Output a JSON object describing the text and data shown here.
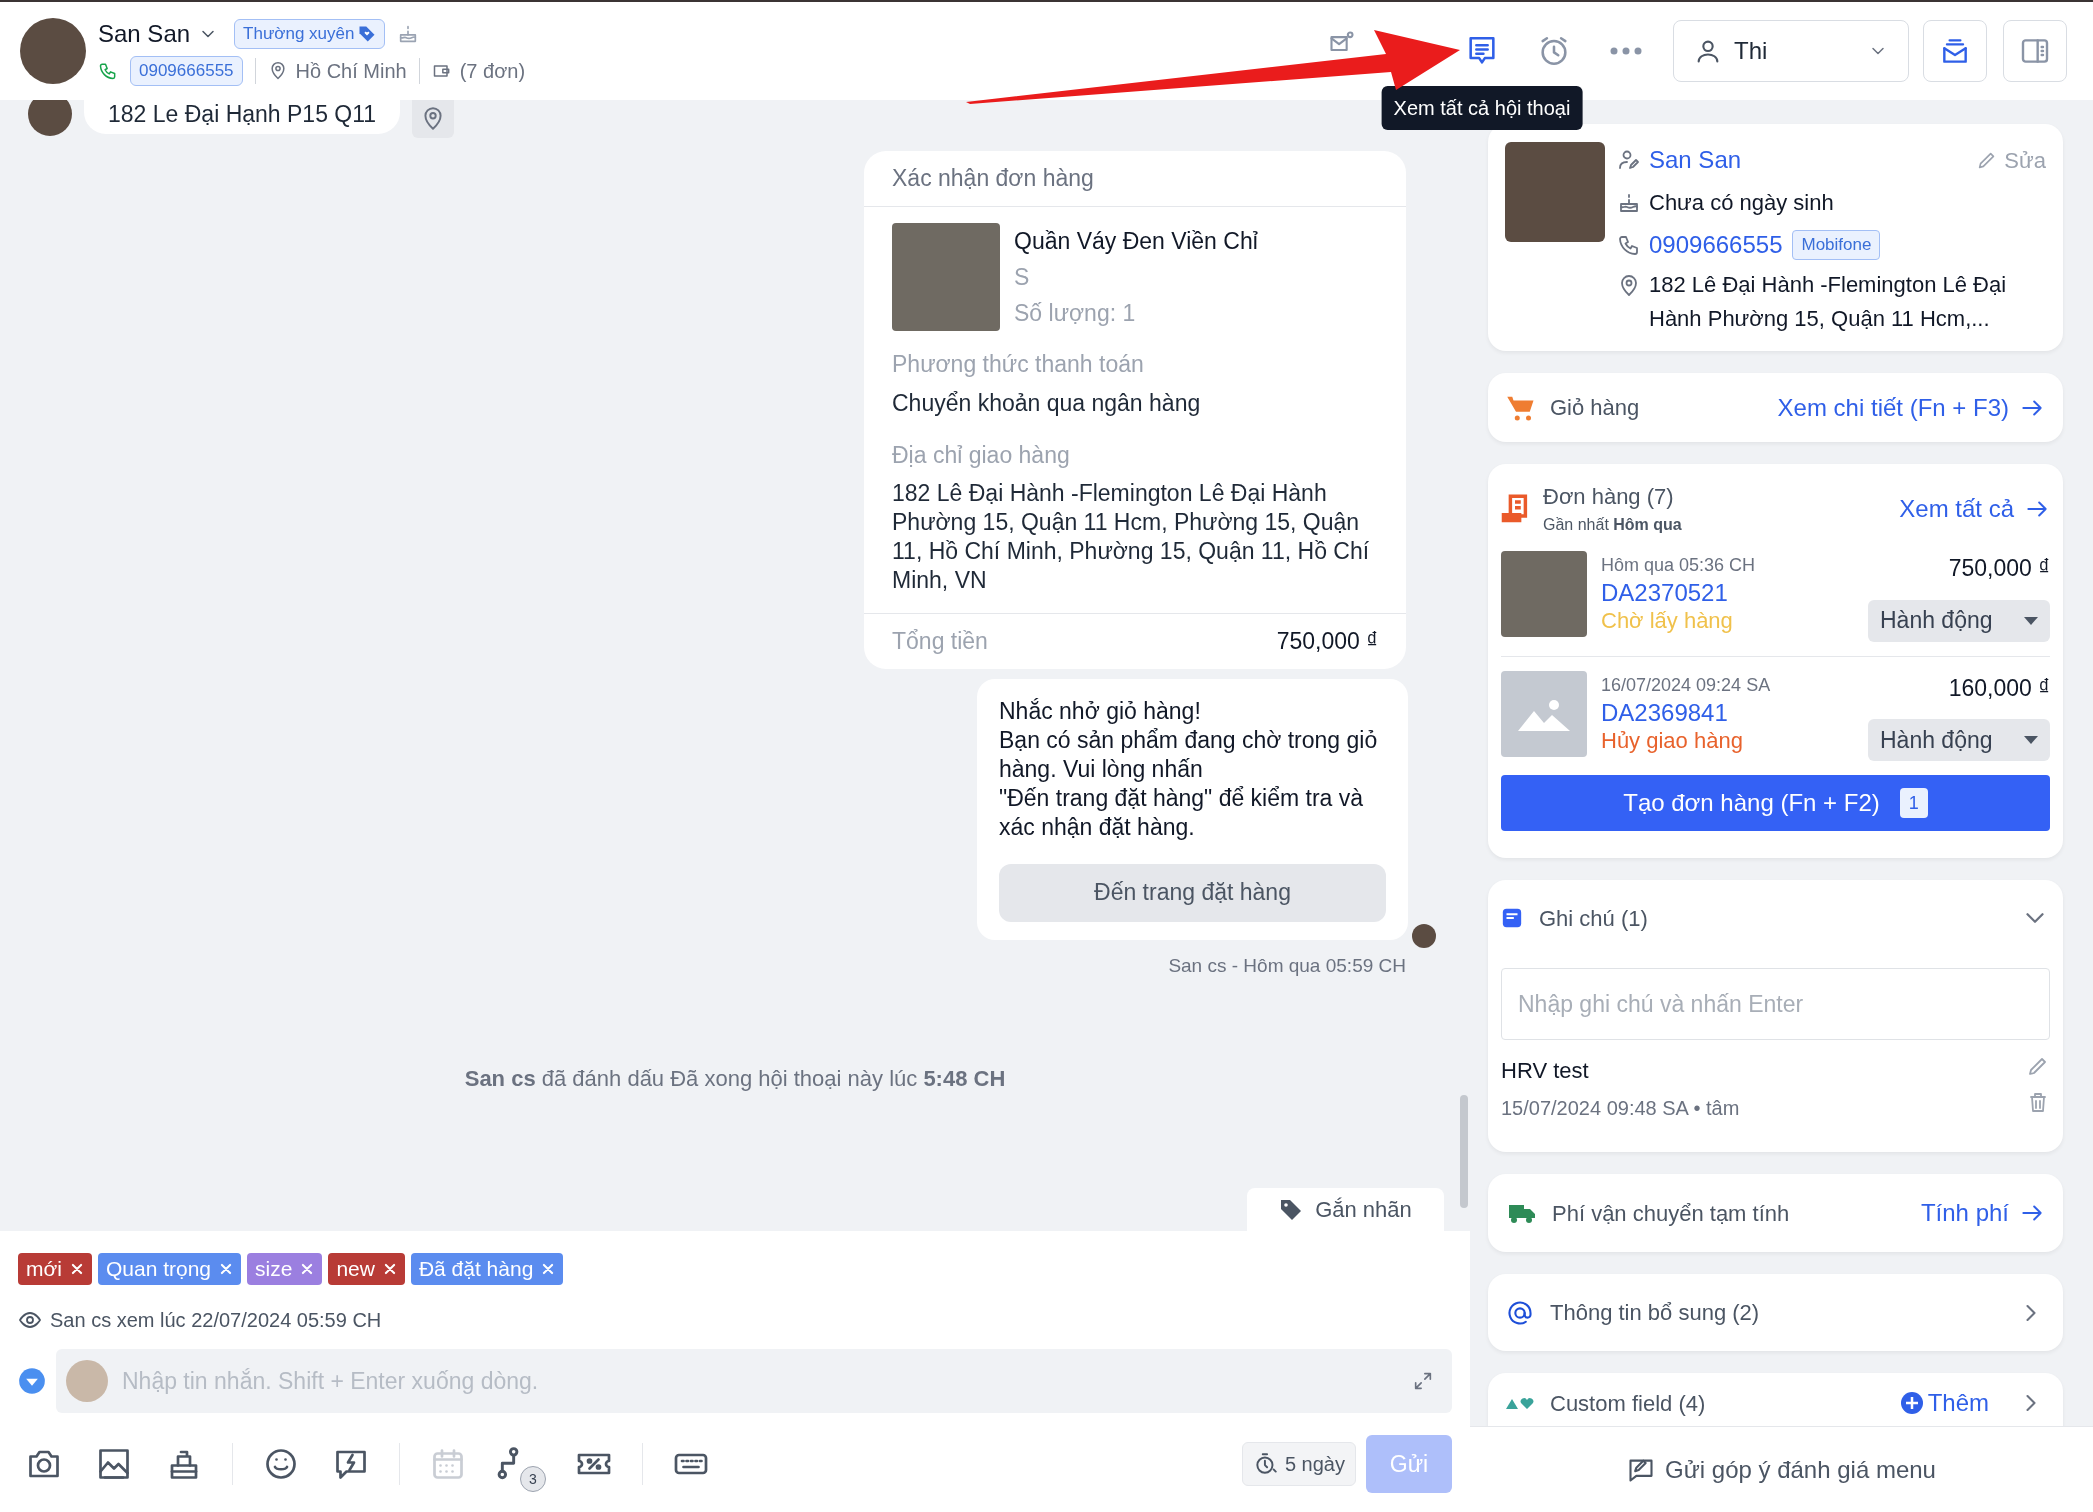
{
  "header": {
    "customer_name": "San San",
    "segment_badge": "Thường xuyên",
    "phone": "0909666555",
    "city": "Hồ Chí Minh",
    "order_count": "(7 đơn)",
    "actions": [
      {
        "kind": "contact",
        "selected": false
      },
      {
        "kind": "conversations",
        "selected": true
      },
      {
        "kind": "reminder",
        "selected": false
      },
      {
        "kind": "more",
        "selected": false
      }
    ],
    "tooltip": "Xem tất cả hội thoại",
    "assignee": "Thi"
  },
  "chat": {
    "address_message": "182 Le Đại Hạnh P15 Q11",
    "order_confirmation": {
      "title": "Xác nhận đơn hàng",
      "product_name": "Quần Váy Đen Viền Chỉ",
      "variant": "S",
      "quantity": "Số lượng: 1",
      "payment_label": "Phương thức thanh toán",
      "payment_value": "Chuyển khoản qua ngân hàng",
      "address_label": "Địa chỉ giao hàng",
      "address_value": "182 Lê Đại Hành -Flemington Lê Đại Hành Phường 15, Quận 11 Hcm, Phường 15, Quận 11, Hồ Chí Minh, Phường 15, Quận 11, Hồ Chí Minh, VN",
      "total_label": "Tổng tiền",
      "total_value": "750,000 ₫"
    },
    "cart_reminder": {
      "text": "Nhắc nhở giỏ hàng!\nBạn có sản phẩm đang chờ trong giỏ hàng. Vui lòng nhấn\n\"Đến trang đặt hàng\" để kiểm tra và xác nhận đặt hàng.",
      "button": "Đến trang đặt hàng",
      "sent_by": "San cs - Hôm qua 05:59 CH"
    },
    "system_message": "**San cs** đã đánh dấu Đã xong hội thoại này lúc **5:48 CH**",
    "label_button": "Gắn nhãn"
  },
  "composer": {
    "tags": [
      {
        "label": "mới",
        "color": "#b83b36"
      },
      {
        "label": "Quan trọng",
        "color": "#5b8cef"
      },
      {
        "label": "size",
        "color": "#9b7fe0"
      },
      {
        "label": "new",
        "color": "#b83b36"
      },
      {
        "label": "Đã đặt hàng",
        "color": "#5b8cef"
      }
    ],
    "seen": "San cs xem lúc 22/07/2024 05:59 CH",
    "placeholder": "Nhập tin nhắn. Shift + Enter xuống dòng.",
    "tools": [
      {
        "kind": "camera",
        "disabled": false
      },
      {
        "kind": "image",
        "disabled": false
      },
      {
        "kind": "product",
        "disabled": false
      },
      {
        "kind": "emoji",
        "disabled": false
      },
      {
        "kind": "quick-reply",
        "disabled": false
      },
      {
        "kind": "calendar",
        "disabled": true
      },
      {
        "kind": "flow",
        "disabled": false,
        "badge": "3"
      },
      {
        "kind": "discount",
        "disabled": false
      },
      {
        "kind": "keyboard",
        "disabled": false
      }
    ],
    "sla": "5 ngày",
    "send": "Gửi",
    "send_disabled": true
  },
  "panel": {
    "customer": {
      "name": "San San",
      "edit": "Sửa",
      "birthday": "Chưa có ngày sinh",
      "phone": "0909666555",
      "carrier": "Mobifone",
      "address": "182 Lê Đại Hành -Flemington Lê Đại Hành Phường 15, Quận 11 Hcm,..."
    },
    "cart": {
      "title": "Giỏ hàng",
      "link": "Xem chi tiết (Fn + F3)"
    },
    "orders": {
      "title": "Đơn hàng (7)",
      "latest": "Gần nhất **Hôm qua**",
      "link": "Xem tất cả",
      "items": [
        {
          "kind": "photo",
          "time": "Hôm qua 05:36 CH",
          "code": "DA2370521",
          "status": "Chờ lấy hàng",
          "color": "#f0c14b",
          "price": "750,000 ₫",
          "action": "Hành động"
        },
        {
          "kind": "placeholder",
          "time": "16/07/2024 09:24 SA",
          "code": "DA2369841",
          "status": "Hủy giao hàng",
          "color": "#e8622c",
          "price": "160,000 ₫",
          "action": "Hành động"
        }
      ],
      "create_button": "Tạo đơn hàng (Fn + F2)",
      "create_badge": "1"
    },
    "notes": {
      "title": "Ghi chú (1)",
      "expanded": true,
      "placeholder": "Nhập ghi chú và nhấn Enter",
      "items": [
        {
          "text": "HRV test",
          "meta": "15/07/2024 09:48 SA • tâm"
        }
      ]
    },
    "shipping": {
      "title": "Phí vận chuyển tạm tính",
      "link": "Tính phí"
    },
    "extra_info": {
      "title": "Thông tin bổ sung (2)",
      "expanded": false
    },
    "custom_fields": {
      "title": "Custom field (4)",
      "add": "Thêm",
      "expanded": false
    },
    "feedback": "Gửi góp ý đánh giá menu"
  }
}
